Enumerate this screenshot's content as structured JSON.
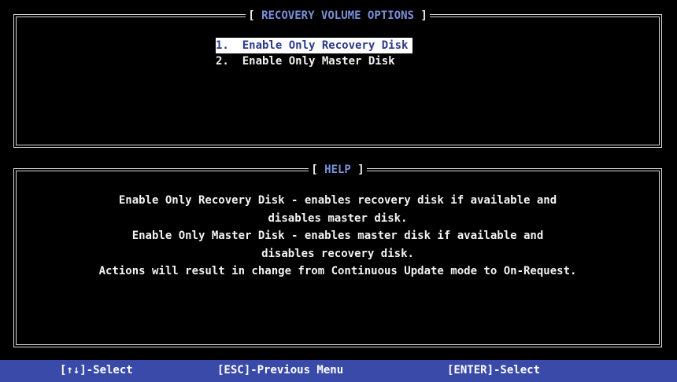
{
  "options_panel": {
    "title_open": "[",
    "title": "RECOVERY VOLUME OPTIONS",
    "title_close": "]",
    "options": [
      {
        "label": "1.  Enable Only Recovery Disk",
        "selected": true
      },
      {
        "label": "2.  Enable Only Master Disk",
        "selected": false
      }
    ]
  },
  "help_panel": {
    "title_open": "[",
    "title": "HELP",
    "title_close": "]",
    "lines": [
      "Enable Only Recovery Disk - enables recovery disk if available and",
      "disables master disk.",
      "Enable Only Master Disk - enables master disk if available and",
      "disables recovery disk.",
      "Actions will result in change from Continuous Update mode to On-Request."
    ]
  },
  "footer": {
    "arrows_select": "[↑↓]-Select",
    "esc_previous": "[ESC]-Previous Menu",
    "enter_select": "[ENTER]-Select"
  },
  "colors": {
    "background": "#000000",
    "title_accent": "#7b8fd8",
    "selection_background": "#ffffff",
    "selection_text": "#2a3a8a",
    "footer_bar": "#3a4aa8",
    "border": "#d8d8d8"
  }
}
